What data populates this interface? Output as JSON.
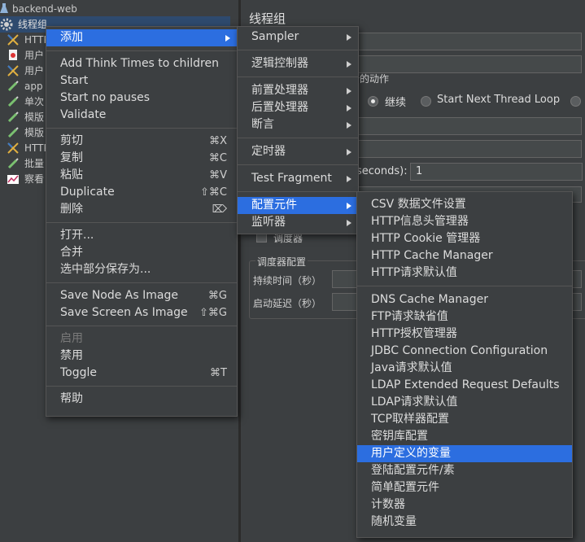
{
  "tree": {
    "items": [
      {
        "label": "backend-web",
        "icon": "flask-icon",
        "color": "#c9c9c9"
      },
      {
        "label": "线程组",
        "icon": "gear-icon",
        "color": "#e0e0e0"
      },
      {
        "label": "HTTP",
        "icon": "http-sampler-icon",
        "color": "#c9c9c9"
      },
      {
        "label": "用户",
        "icon": "user-vars-icon",
        "color": "#c9c9c9"
      },
      {
        "label": "用户",
        "icon": "http-sampler-icon",
        "color": "#c9c9c9"
      },
      {
        "label": "app",
        "icon": "pipette-icon",
        "color": "#c9c9c9"
      },
      {
        "label": "单次",
        "icon": "pipette-icon",
        "color": "#c9c9c9"
      },
      {
        "label": "模版",
        "icon": "pipette-icon",
        "color": "#c9c9c9"
      },
      {
        "label": "模版",
        "icon": "pipette-icon",
        "color": "#c9c9c9"
      },
      {
        "label": "HTTP",
        "icon": "http-sampler-icon",
        "color": "#c9c9c9"
      },
      {
        "label": "批量",
        "icon": "pipette-icon",
        "color": "#c9c9c9"
      },
      {
        "label": "察看",
        "icon": "listener-icon",
        "color": "#c9c9c9"
      }
    ]
  },
  "panel": {
    "title": "线程组",
    "action_group_title": "行的动作",
    "radio_continue": "继续",
    "radio_start_next": "Start Next Thread Loop",
    "seconds_label": "seconds):",
    "seconds_value": "1",
    "scheduler_checkbox": "调度器",
    "scheduler_group": "调度器配置",
    "duration_label": "持续时间（秒）",
    "delay_label": "启动延迟（秒）"
  },
  "context_menu": {
    "items": [
      {
        "label": "添加",
        "type": "submenu",
        "selected": true
      },
      {
        "type": "sep"
      },
      {
        "label": "Add Think Times to children"
      },
      {
        "label": "Start"
      },
      {
        "label": "Start no pauses"
      },
      {
        "label": "Validate"
      },
      {
        "type": "sep"
      },
      {
        "label": "剪切",
        "shortcut": "⌘X"
      },
      {
        "label": "复制",
        "shortcut": "⌘C"
      },
      {
        "label": "粘贴",
        "shortcut": "⌘V"
      },
      {
        "label": "Duplicate",
        "shortcut": "⇧⌘C"
      },
      {
        "label": "删除",
        "shortcut": "⌦"
      },
      {
        "type": "sep"
      },
      {
        "label": "打开..."
      },
      {
        "label": "合并"
      },
      {
        "label": "选中部分保存为..."
      },
      {
        "type": "sep"
      },
      {
        "label": "Save Node As Image",
        "shortcut": "⌘G"
      },
      {
        "label": "Save Screen As Image",
        "shortcut": "⇧⌘G"
      },
      {
        "type": "sep"
      },
      {
        "label": "启用",
        "disabled": true
      },
      {
        "label": "禁用"
      },
      {
        "label": "Toggle",
        "shortcut": "⌘T"
      },
      {
        "type": "sep"
      },
      {
        "label": "帮助"
      }
    ]
  },
  "add_submenu": {
    "items": [
      {
        "label": "Sampler",
        "type": "submenu"
      },
      {
        "type": "sep"
      },
      {
        "label": "逻辑控制器",
        "type": "submenu"
      },
      {
        "type": "sep"
      },
      {
        "label": "前置处理器",
        "type": "submenu"
      },
      {
        "label": "后置处理器",
        "type": "submenu"
      },
      {
        "label": "断言",
        "type": "submenu"
      },
      {
        "type": "sep"
      },
      {
        "label": "定时器",
        "type": "submenu"
      },
      {
        "type": "sep"
      },
      {
        "label": "Test Fragment",
        "type": "submenu"
      },
      {
        "type": "sep"
      },
      {
        "label": "配置元件",
        "type": "submenu",
        "selected": true
      },
      {
        "label": "监听器",
        "type": "submenu"
      }
    ]
  },
  "config_submenu": {
    "items": [
      {
        "label": "CSV 数据文件设置"
      },
      {
        "label": "HTTP信息头管理器"
      },
      {
        "label": "HTTP Cookie 管理器"
      },
      {
        "label": "HTTP Cache Manager"
      },
      {
        "label": "HTTP请求默认值"
      },
      {
        "type": "sep"
      },
      {
        "label": "DNS Cache Manager"
      },
      {
        "label": "FTP请求缺省值"
      },
      {
        "label": "HTTP授权管理器"
      },
      {
        "label": "JDBC Connection Configuration"
      },
      {
        "label": "Java请求默认值"
      },
      {
        "label": "LDAP Extended Request Defaults"
      },
      {
        "label": "LDAP请求默认值"
      },
      {
        "label": "TCP取样器配置"
      },
      {
        "label": "密钥库配置"
      },
      {
        "label": "用户定义的变量",
        "selected": true
      },
      {
        "label": "登陆配置元件/素"
      },
      {
        "label": "简单配置元件"
      },
      {
        "label": "计数器"
      },
      {
        "label": "随机变量"
      }
    ]
  },
  "colors": {
    "accent": "#2c6ee0",
    "background": "#3c3f41"
  }
}
